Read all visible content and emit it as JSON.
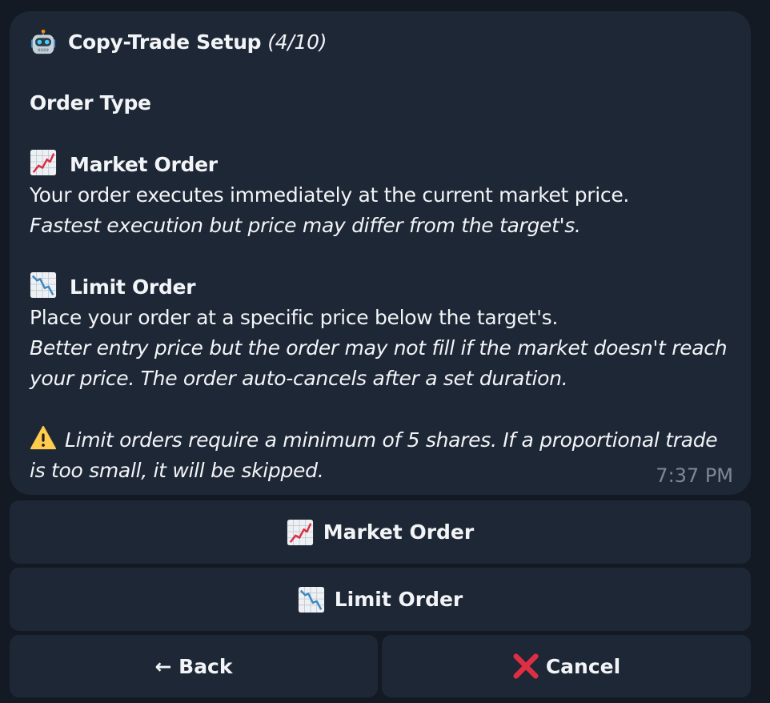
{
  "message": {
    "title": "Copy-Trade Setup",
    "step": "(4/10)",
    "section_heading": "Order Type",
    "market": {
      "heading": "Market Order",
      "desc": "Your order executes immediately at the current market price.",
      "note": "Fastest execution but price may differ from the target's."
    },
    "limit": {
      "heading": "Limit Order",
      "desc": "Place your order at a specific price below the target's.",
      "note_line1": "Better entry price but the order may not fill if the market doesn't reach",
      "note_line2": "your price. The order auto-cancels after a set duration."
    },
    "warning_line1": "Limit orders require a minimum of 5 shares. If a proportional trade",
    "warning_line2": "is too small, it will be skipped.",
    "time": "7:37 PM"
  },
  "buttons": {
    "market": "Market Order",
    "limit": "Limit Order",
    "back": "← Back",
    "cancel": "Cancel"
  },
  "icons": [
    "robot-icon",
    "chart-increasing-icon",
    "chart-decreasing-icon",
    "warning-icon",
    "cross-mark-icon"
  ]
}
